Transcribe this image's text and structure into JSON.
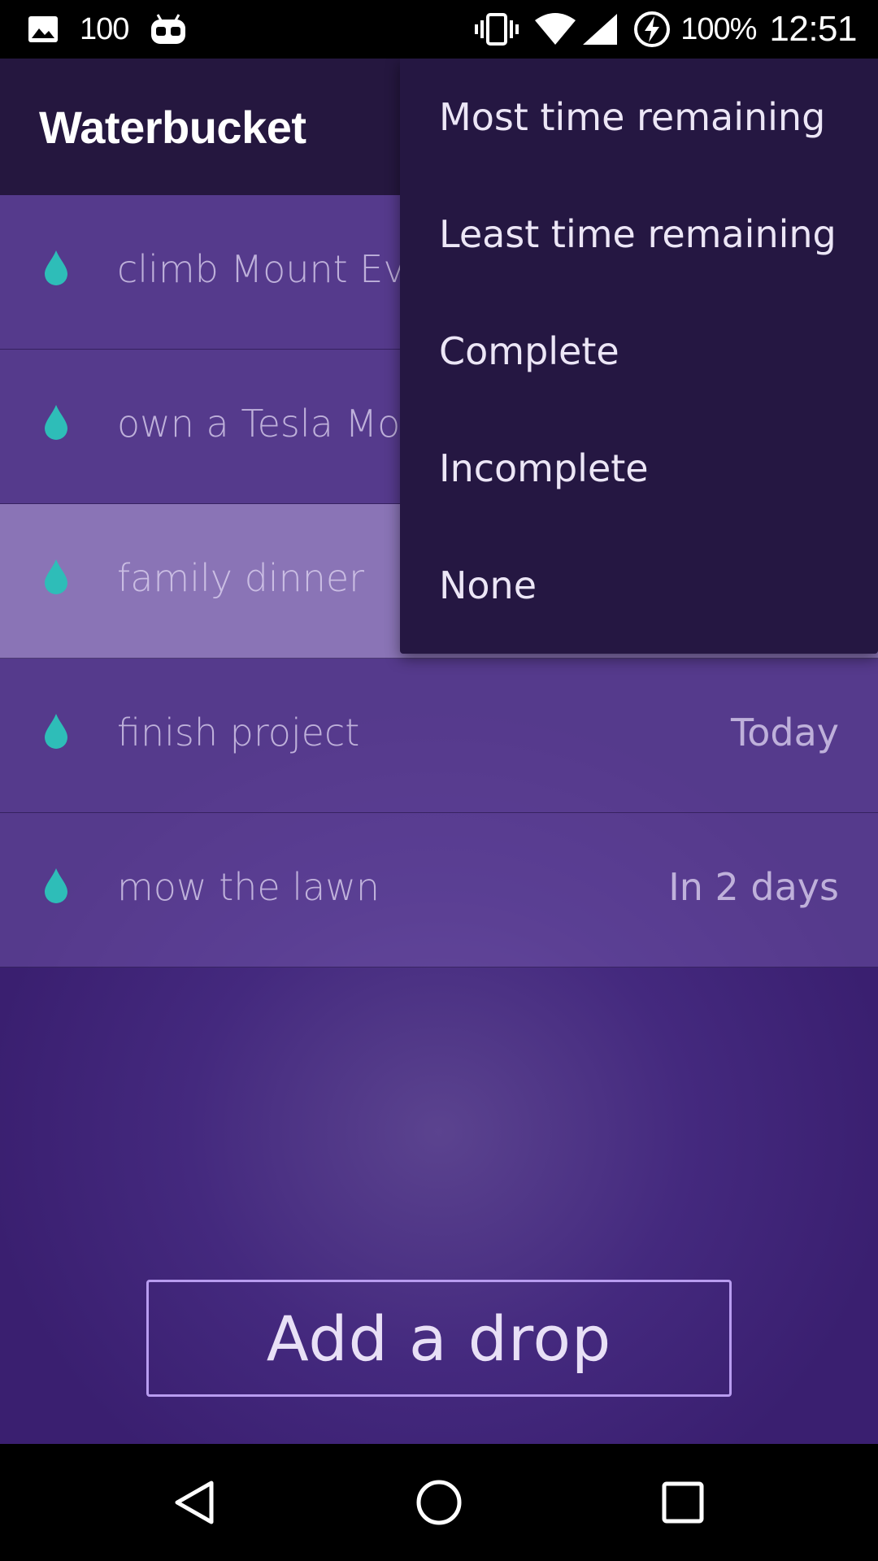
{
  "status_bar": {
    "notification_count": "100",
    "battery": "100%",
    "time": "12:51",
    "icons": [
      "image-icon",
      "android-debug-icon",
      "vibrate-icon",
      "wifi-icon",
      "signal-icon",
      "battery-charging-icon"
    ]
  },
  "app": {
    "title": "Waterbucket"
  },
  "list": {
    "items": [
      {
        "title": "climb Mount Eve",
        "due": ""
      },
      {
        "title": "own a Tesla Moc",
        "due": ""
      },
      {
        "title": "family dinner",
        "due": ""
      },
      {
        "title": "finish project",
        "due": "Today"
      },
      {
        "title": "mow the lawn",
        "due": "In 2 days"
      }
    ]
  },
  "menu": {
    "items": [
      "Most time remaining",
      "Least time remaining",
      "Complete",
      "Incomplete",
      "None"
    ]
  },
  "add_button": {
    "label": "Add a drop"
  },
  "colors": {
    "toolbar": "#25173f",
    "menu": "#251742",
    "drop": "#2ebdb8",
    "button_border": "#b89cf0"
  },
  "nav_bar": {
    "icons": [
      "back-icon",
      "home-icon",
      "recents-icon"
    ]
  }
}
